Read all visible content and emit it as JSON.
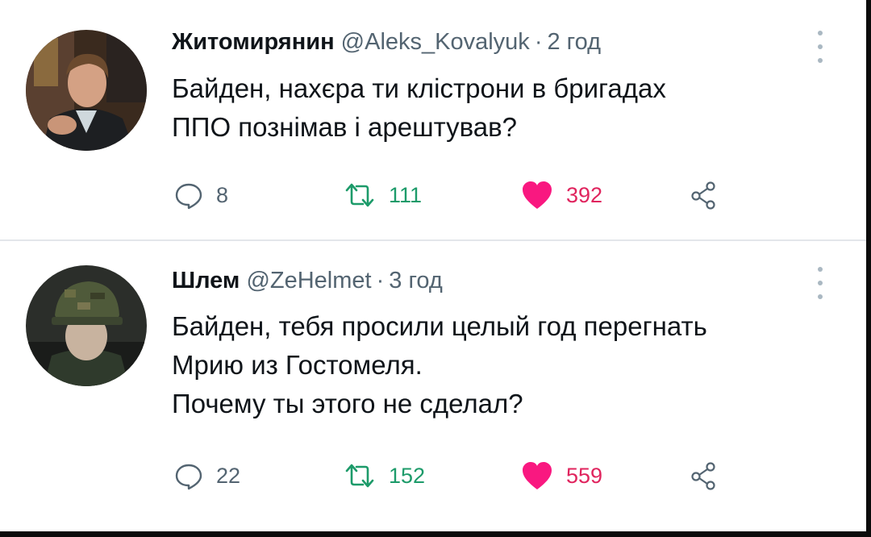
{
  "tweets": [
    {
      "author_name": "Житомирянин",
      "handle": "@Aleks_Kovalyuk",
      "separator": "·",
      "time": "2 год",
      "lines": [
        "Байден, нахєра ти клістрони в бригадах",
        "ППО познімав і арештував?"
      ],
      "replies": "8",
      "retweets": "111",
      "likes": "392"
    },
    {
      "author_name": "Шлем",
      "handle": "@ZeHelmet",
      "separator": "·",
      "time": "3 год",
      "lines": [
        "Байден, тебя просили целый год перегнать",
        "Мрию из Гостомеля.",
        "Почему ты этого не сделал?"
      ],
      "replies": "22",
      "retweets": "152",
      "likes": "559"
    }
  ],
  "icons": {
    "reply": "speech-bubble-icon",
    "retweet": "retweet-arrows-icon",
    "like": "heart-icon",
    "share": "share-nodes-icon",
    "more": "vertical-ellipsis-icon"
  },
  "colors": {
    "text": "#0f1419",
    "secondary": "#536471",
    "retweet": "#1d9b6a",
    "like": "#e0245e",
    "divider": "#e3e6ea"
  }
}
